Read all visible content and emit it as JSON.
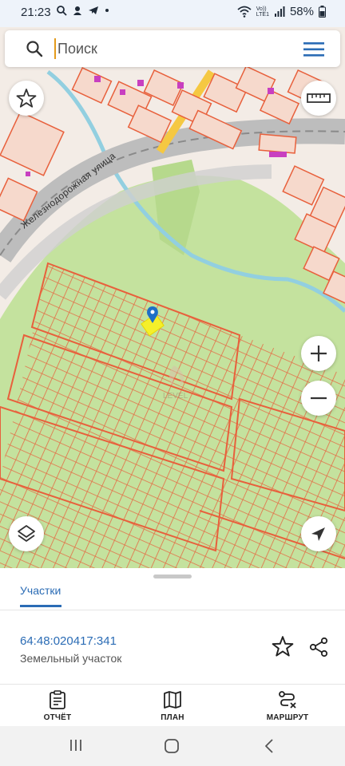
{
  "status_bar": {
    "time": "21:23",
    "network_label": "Vo))\nLTE1",
    "battery": "58%"
  },
  "search": {
    "placeholder": "Поиск",
    "value": ""
  },
  "map": {
    "street_label": "Железнодорожная улица",
    "watermark": "LEVEL",
    "colors": {
      "parcel_outline": "#e8603c",
      "green_area": "#c4e29e",
      "river": "#92cfe0",
      "road": "#bdbdbd",
      "main_road": "#f5c842",
      "selected_parcel": "#f5ef2a",
      "marker": "#1e6fc6",
      "building": "#c83fc0"
    }
  },
  "sheet": {
    "tab_label": "Участки",
    "parcel_number": "64:48:020417:341",
    "parcel_type": "Земельный участок"
  },
  "actions": [
    {
      "label": "ОТЧЁТ",
      "icon": "clipboard-icon"
    },
    {
      "label": "ПЛАН",
      "icon": "map-icon"
    },
    {
      "label": "МАРШРУТ",
      "icon": "route-icon"
    }
  ],
  "accent_color": "#2b6cb5"
}
